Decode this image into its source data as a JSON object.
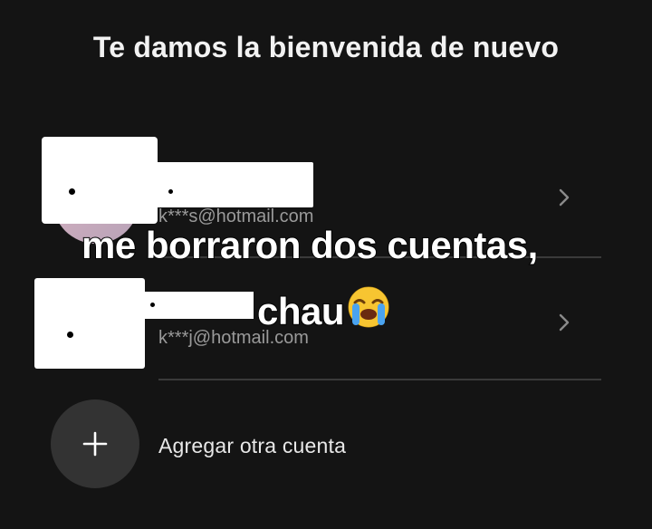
{
  "header": {
    "title": "Te damos la bienvenida de nuevo"
  },
  "accounts": [
    {
      "email": "k***s@hotmail.com",
      "icon": "chevron-right-icon"
    },
    {
      "email": "k***j@hotmail.com",
      "icon": "chevron-right-icon"
    }
  ],
  "add_account": {
    "label": "Agregar otra cuenta",
    "icon": "plus-icon"
  },
  "overlay": {
    "line1": "me borraron dos cuentas,",
    "line2": "chau",
    "emoji": "loudly-crying-face-icon"
  },
  "colors": {
    "background": "#141414",
    "muted_text": "#9a9a9a",
    "circle": "#333333",
    "divider": "#3a3a3a"
  }
}
